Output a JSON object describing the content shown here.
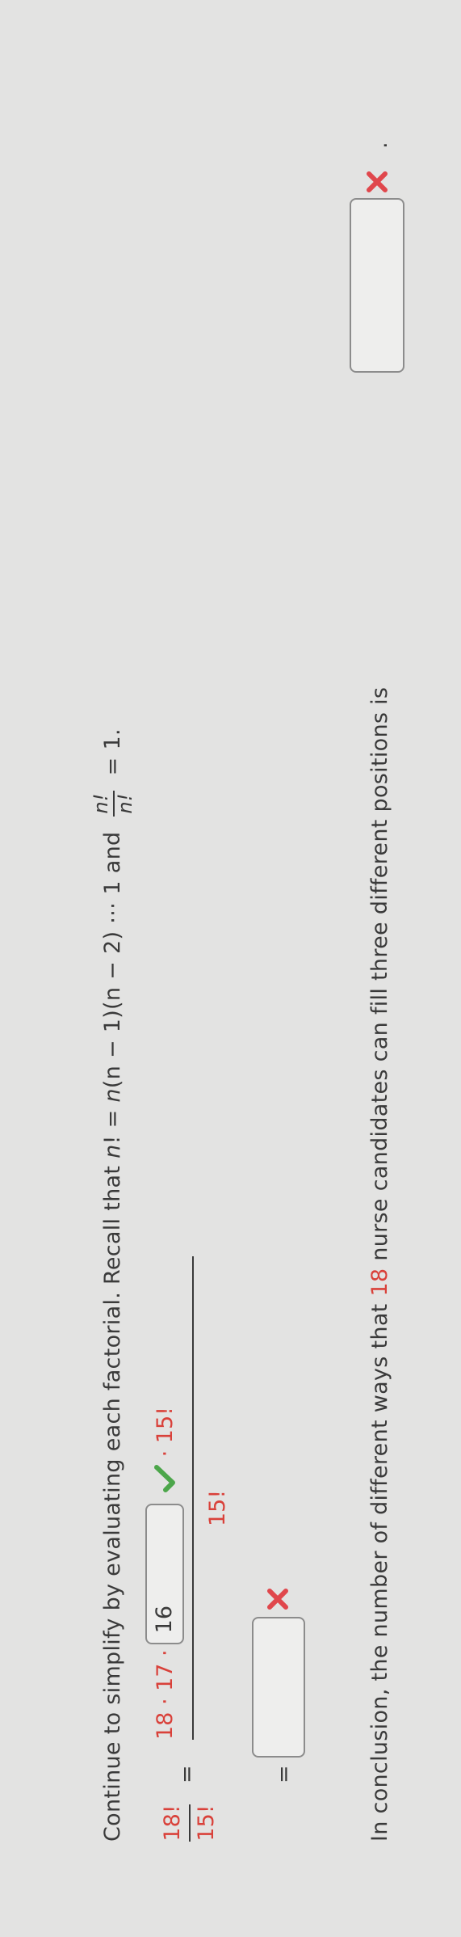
{
  "instruction": {
    "prefix": "Continue to simplify by evaluating each factorial. Recall that ",
    "formula_n": "n",
    "formula_mid": "! = ",
    "formula_n2": "n",
    "formula_rest": "(n − 1)(n − 2) ⋯ 1 and",
    "frac_num": "n!",
    "frac_den": "n!",
    "suffix": "= 1."
  },
  "step1": {
    "lhs_num": "18!",
    "lhs_den": "15!",
    "equals": "=",
    "num_prefix": "18 · 17 ·",
    "answer_value": "16",
    "answer_status": "correct",
    "num_suffix": "· 15!",
    "denominator": "15!"
  },
  "step2": {
    "equals": "=",
    "answer_value": "",
    "answer_status": "incorrect"
  },
  "conclusion": {
    "text_a": "In conclusion, the number of different ways that ",
    "number": "18",
    "text_b": " nurse candidates can fill three different positions is",
    "answer_value": "",
    "answer_status": "incorrect",
    "end": "."
  },
  "colors": {
    "accent_red": "#d9413a",
    "check_green": "#4ca64a",
    "text": "#3a3a3a",
    "background": "#e3e3e2"
  },
  "icons": {
    "correct": "checkmark-icon",
    "incorrect": "x-mark-icon"
  }
}
